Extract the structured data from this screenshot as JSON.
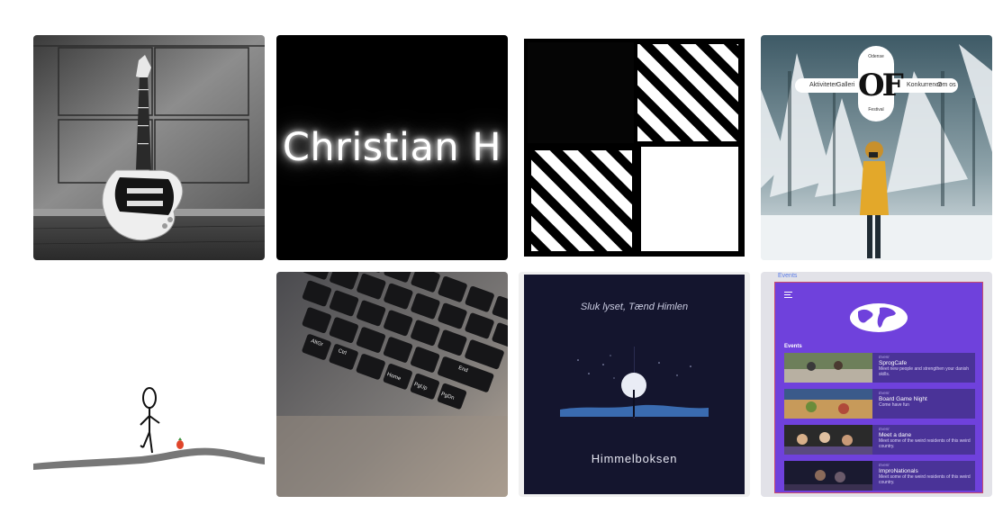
{
  "gallery": {
    "items": [
      {
        "id": "guitar",
        "alt": "Electric guitar leaning against a wall"
      },
      {
        "id": "christian-h",
        "text": "Christian H"
      },
      {
        "id": "abstract-squares",
        "alt": "Hand drawn checker squares"
      },
      {
        "id": "odense-festival",
        "nav": {
          "left": [
            "Aktiviteter",
            "Galleri"
          ],
          "right": [
            "Konkurrence",
            "Om os"
          ]
        },
        "logo": {
          "top": "Odense",
          "mark": "OF",
          "bottom": "Festival"
        }
      },
      {
        "id": "stickman-game",
        "alt": "Stick figure on a hill"
      },
      {
        "id": "keyboard",
        "alt": "Laptop keyboard close-up",
        "keys": [
          "AltGr",
          "Ctrl",
          "Home",
          "PgUp",
          "PgDn",
          "End"
        ]
      },
      {
        "id": "himmelboksen",
        "tagline": "Sluk lyset, Tænd Himlen",
        "brand": "Himmelboksen"
      },
      {
        "id": "events-app",
        "tab": "Events",
        "section": "Events",
        "events": [
          {
            "kind": "Event",
            "title": "SprogCafe",
            "desc": "Meet new people and strengthen your danish skills."
          },
          {
            "kind": "Event",
            "title": "Board Game Night",
            "desc": "Come have fun"
          },
          {
            "kind": "Event",
            "title": "Meet a dane",
            "desc": "Meet some of the weird residents of this weird country."
          },
          {
            "kind": "Event",
            "title": "ImproNationals",
            "desc": "Meet some of the weird residents of this weird country."
          }
        ]
      }
    ]
  }
}
